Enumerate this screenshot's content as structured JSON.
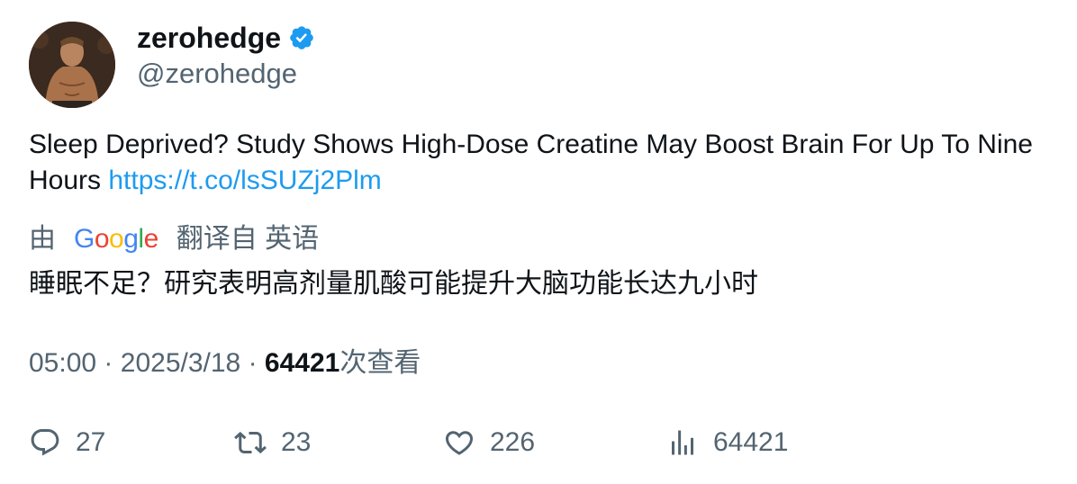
{
  "author": {
    "display_name": "zerohedge",
    "handle": "@zerohedge",
    "verified": true,
    "avatar_icon": "avatar"
  },
  "tweet": {
    "text": "Sleep Deprived? Study Shows High-Dose Creatine May Boost Brain For Up To Nine Hours",
    "link": "https://t.co/lsSUZj2Plm"
  },
  "translation": {
    "prefix": "由",
    "provider": "Google",
    "suffix": "翻译自 英语",
    "text": "睡眠不足？研究表明高剂量肌酸可能提升大脑功能长达九小时"
  },
  "meta": {
    "time": "05:00",
    "separator": "·",
    "date": "2025/3/18",
    "views": "64421",
    "views_label": "次查看"
  },
  "actions": {
    "replies": "27",
    "retweets": "23",
    "likes": "226",
    "views": "64421"
  },
  "colors": {
    "link": "#1d9bf0",
    "secondary_text": "#536471",
    "primary_text": "#0f1419",
    "verified": "#1d9bf0"
  }
}
